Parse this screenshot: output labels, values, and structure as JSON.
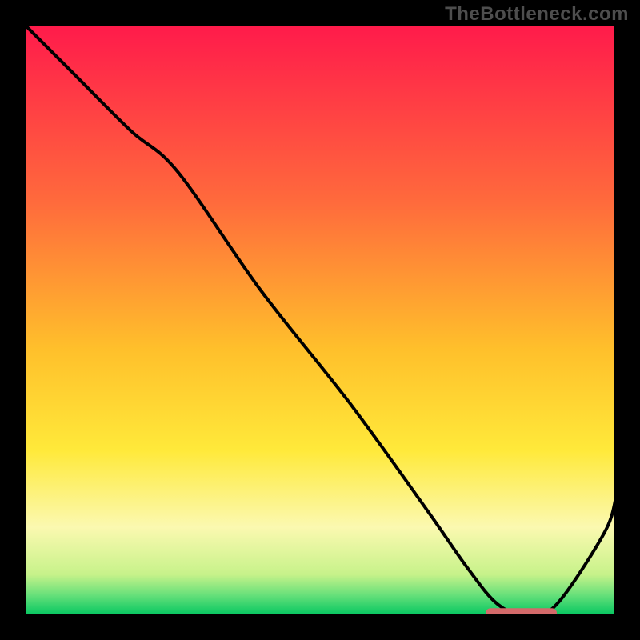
{
  "watermark": "TheBottleneck.com",
  "chart_data": {
    "type": "line",
    "title": "",
    "xlabel": "",
    "ylabel": "",
    "xlim": [
      0,
      100
    ],
    "ylim": [
      0,
      100
    ],
    "grid": false,
    "axes_visible": false,
    "background_gradient": {
      "stops": [
        {
          "pos": 0.0,
          "color": "#ff1a4b"
        },
        {
          "pos": 0.3,
          "color": "#ff6a3c"
        },
        {
          "pos": 0.55,
          "color": "#ffc02b"
        },
        {
          "pos": 0.72,
          "color": "#ffe93a"
        },
        {
          "pos": 0.85,
          "color": "#fbf9b0"
        },
        {
          "pos": 0.93,
          "color": "#c7f28a"
        },
        {
          "pos": 0.965,
          "color": "#66e07a"
        },
        {
          "pos": 1.0,
          "color": "#00c560"
        }
      ]
    },
    "curve": {
      "name": "bottleneck-curve",
      "x": [
        0,
        8,
        18,
        26,
        40,
        55,
        68,
        75,
        80,
        85,
        90,
        98,
        100
      ],
      "y": [
        100,
        92,
        82,
        75,
        55,
        36,
        18,
        8,
        2,
        0,
        2,
        14,
        20
      ]
    },
    "optimal_marker": {
      "x_start": 78,
      "x_end": 90,
      "y": 0.5,
      "color": "#d46a6a"
    }
  }
}
